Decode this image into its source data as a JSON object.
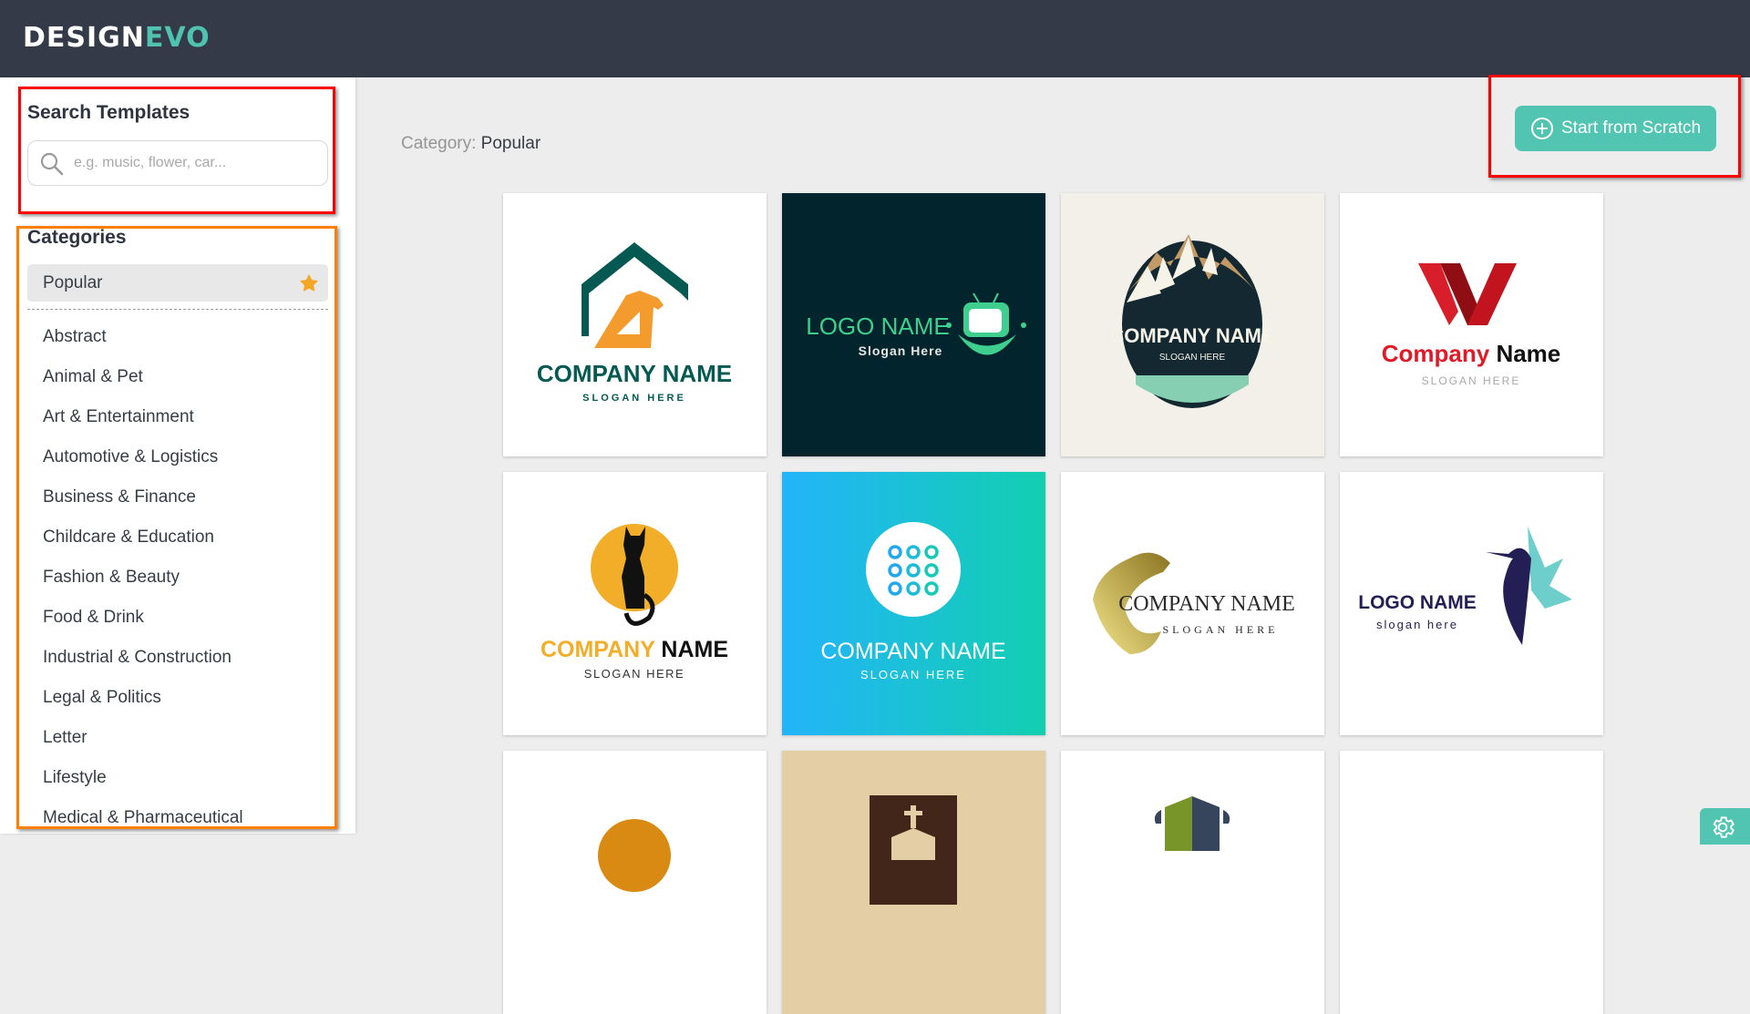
{
  "header": {
    "brand_part1": "DESIGN",
    "brand_part2": "EVO"
  },
  "sidebar": {
    "search_title": "Search Templates",
    "search_placeholder": "e.g. music, flower, car...",
    "search_value": "",
    "categories_title": "Categories",
    "active_category": "Popular",
    "categories": [
      "Abstract",
      "Animal & Pet",
      "Art & Entertainment",
      "Automotive & Logistics",
      "Business & Finance",
      "Childcare & Education",
      "Fashion & Beauty",
      "Food & Drink",
      "Industrial & Construction",
      "Legal & Politics",
      "Letter",
      "Lifestyle",
      "Medical & Pharmaceutical"
    ]
  },
  "main": {
    "category_label": "Category:",
    "category_value": "Popular",
    "start_button": "Start from Scratch",
    "templates": [
      {
        "icon": "house-hammer-icon",
        "name": "COMPANY NAME",
        "slogan": "SLOGAN HERE",
        "bg": "#ffffff"
      },
      {
        "icon": "tv-icon",
        "name": "LOGO NAME",
        "slogan": "Slogan Here",
        "bg": "#02252d"
      },
      {
        "icon": "mountain-badge-icon",
        "name": "COMPANY NAME",
        "slogan": "SLOGAN HERE",
        "bg": "#f3f0e9"
      },
      {
        "icon": "letter-w-icon",
        "name_part1": "Company",
        "name_part2": "Name",
        "slogan": "SLOGAN HERE",
        "bg": "#ffffff"
      },
      {
        "icon": "cat-moon-icon",
        "name_part1": "COMPANY",
        "name_part2": "NAME",
        "slogan": "SLOGAN HERE",
        "bg": "#ffffff"
      },
      {
        "icon": "dot-grid-icon",
        "name": "COMPANY NAME",
        "slogan": "SLOGAN HERE",
        "bg": "gradient"
      },
      {
        "icon": "dragon-icon",
        "name": "COMPANY NAME",
        "slogan": "SLOGAN HERE",
        "bg": "#ffffff"
      },
      {
        "icon": "hummingbird-icon",
        "name": "LOGO NAME",
        "slogan": "slogan here",
        "bg": "#ffffff"
      },
      {
        "icon": "orange-circle-icon",
        "bg": "#ffffff"
      },
      {
        "icon": "church-icon",
        "bg": "#e4cea6"
      },
      {
        "icon": "shield-house-icon",
        "bg": "#ffffff"
      },
      {
        "icon": "blank",
        "bg": "#ffffff"
      }
    ]
  },
  "colors": {
    "accent": "#52c5b2",
    "header_bg": "#343a48",
    "star": "#f5a623"
  }
}
